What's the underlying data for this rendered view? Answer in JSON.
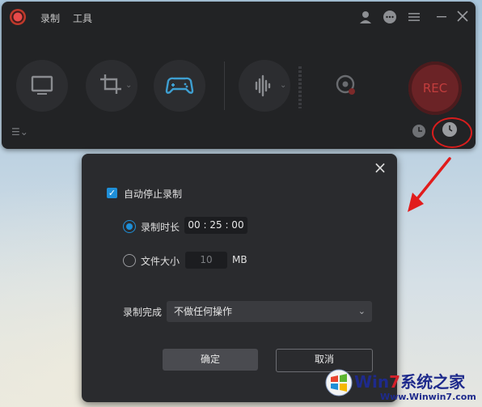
{
  "menu": {
    "record": "录制",
    "tools": "工具"
  },
  "record_button": "REC",
  "dialog": {
    "auto_stop_label": "自动停止录制",
    "auto_stop_checked": true,
    "duration_label": "录制时长",
    "duration_value": "00 : 25 : 00",
    "duration_selected": true,
    "filesize_label": "文件大小",
    "filesize_value": "10",
    "filesize_unit": "MB",
    "on_complete_label": "录制完成",
    "on_complete_value": "不做任何操作",
    "ok_label": "确定",
    "cancel_label": "取消"
  },
  "watermark": {
    "brand_prefix": "Win",
    "brand_seven": "7",
    "brand_suffix": "系统之家",
    "url": "Www.Winwin7.com"
  },
  "colors": {
    "accent": "#1e8fd8",
    "rec": "#6b2326",
    "highlight": "#d81d1d"
  }
}
